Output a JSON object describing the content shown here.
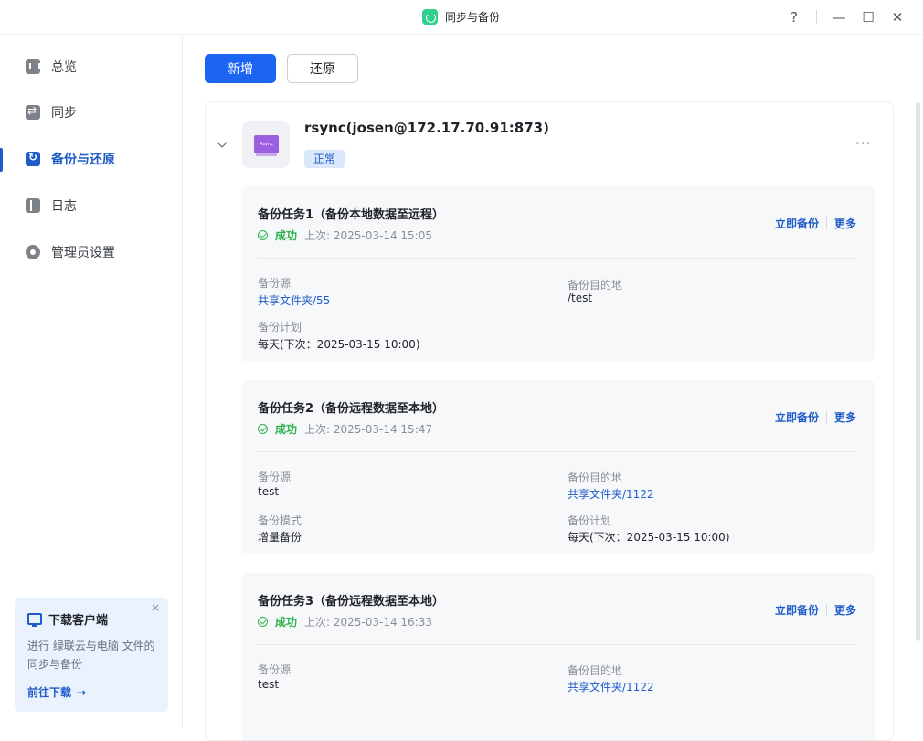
{
  "window": {
    "title": "同步与备份",
    "help_label": "?",
    "minimize_label": "—",
    "maximize_label": "☐",
    "close_label": "✕"
  },
  "sidebar": {
    "items": [
      {
        "label": "总览",
        "icon": "overview-icon"
      },
      {
        "label": "同步",
        "icon": "sync-icon"
      },
      {
        "label": "备份与还原",
        "icon": "backup-restore-icon",
        "active": true
      },
      {
        "label": "日志",
        "icon": "log-icon"
      },
      {
        "label": "管理员设置",
        "icon": "admin-settings-icon"
      }
    ],
    "promo": {
      "title": "下载客户端",
      "close": "×",
      "desc_line1": "进行 绿联云与电脑 文件的",
      "desc_line2": "同步与备份",
      "link": "前往下载",
      "link_arrow": "→"
    }
  },
  "toolbar": {
    "add_label": "新增",
    "restore_label": "还原"
  },
  "server": {
    "name": "rsync(josen@172.17.70.91:873)",
    "status": "正常",
    "logo_text": "Rsync",
    "more": "···"
  },
  "tasks": [
    {
      "title": "备份任务1（备份本地数据至远程）",
      "status": "成功",
      "last_run": "上次: 2025-03-14 15:05",
      "actions": {
        "backup_now": "立即备份",
        "more": "更多"
      },
      "fields": [
        {
          "label": "备份源",
          "value": "共享文件夹/55",
          "link": true
        },
        {
          "label": "备份目的地",
          "value": "/test",
          "link": false
        },
        {
          "label": "备份计划",
          "value": "每天(下次：2025-03-15 10:00)",
          "link": false
        }
      ]
    },
    {
      "title": "备份任务2（备份远程数据至本地）",
      "status": "成功",
      "last_run": "上次: 2025-03-14 15:47",
      "actions": {
        "backup_now": "立即备份",
        "more": "更多"
      },
      "fields": [
        {
          "label": "备份源",
          "value": "test",
          "link": false
        },
        {
          "label": "备份目的地",
          "value": "共享文件夹/1122",
          "link": true
        },
        {
          "label": "备份模式",
          "value": "增量备份",
          "link": false
        },
        {
          "label": "备份计划",
          "value": "每天(下次：2025-03-15 10:00)",
          "link": false
        }
      ]
    },
    {
      "title": "备份任务3（备份远程数据至本地）",
      "status": "成功",
      "last_run": "上次: 2025-03-14 16:33",
      "actions": {
        "backup_now": "立即备份",
        "more": "更多"
      },
      "fields": [
        {
          "label": "备份源",
          "value": "test",
          "link": false
        },
        {
          "label": "备份目的地",
          "value": "共享文件夹/1122",
          "link": true
        }
      ]
    }
  ]
}
